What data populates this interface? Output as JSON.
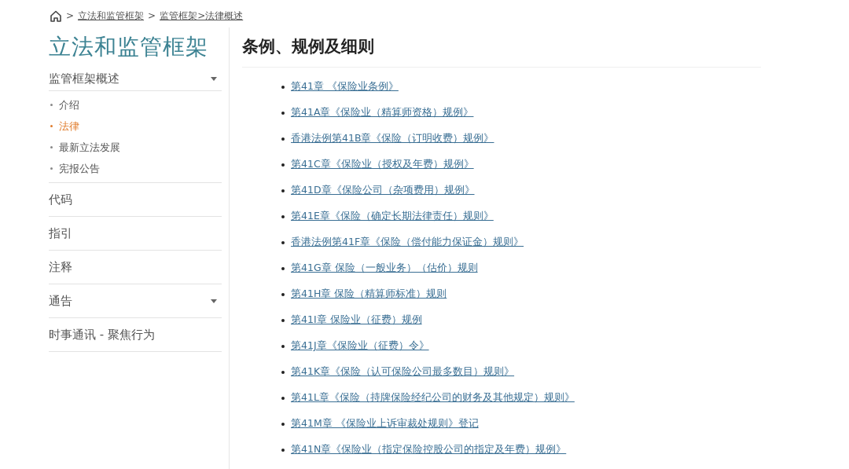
{
  "breadcrumb": [
    {
      "separator": ">",
      "text": "立法和监管框架"
    },
    {
      "separator": ">",
      "text": "监管框架>法律概述"
    }
  ],
  "sidebar": {
    "title": "立法和监管框架",
    "sections": [
      {
        "label": "监管框架概述",
        "expandable": true,
        "children": [
          {
            "label": "介绍",
            "selected": false
          },
          {
            "label": "法律",
            "selected": true
          },
          {
            "label": "最新立法发展",
            "selected": false
          },
          {
            "label": "宪报公告",
            "selected": false
          }
        ]
      },
      {
        "label": "代码",
        "expandable": false
      },
      {
        "label": "指引",
        "expandable": false
      },
      {
        "label": "注释",
        "expandable": false
      },
      {
        "label": "通告",
        "expandable": true
      },
      {
        "label": "时事通讯 - 聚焦行为",
        "expandable": false
      }
    ]
  },
  "main": {
    "heading": "条例、规例及细则",
    "links": [
      "第41章 《保险业条例》",
      "第41A章《保险业（精算师资格）规例》",
      "香港法例第41B章《保险（订明收费）规例》",
      "第41C章《保险业（授权及年费）规例》",
      "第41D章《保险公司（杂项费用）规例》",
      "第41E章《保险（确定长期法律责任）规则》",
      "香港法例第41F章《保险（偿付能力保证金）规则》",
      "第41G章 保险（一般业务）（估价）规则",
      "第41H章 保险（精算师标准）规则",
      "第41I章 保险业（征费）规例",
      "第41J章《保险业（征费）令》",
      "第41K章《保险（认可保险公司最多数目）规则》",
      "第41L章《保险（持牌保险经纪公司的财务及其他规定）规则》",
      "第41M章 《保险业上诉审裁处规则》登记",
      "第41N章《保险业（指定保险控股公司的指定及年费）规例》"
    ]
  }
}
